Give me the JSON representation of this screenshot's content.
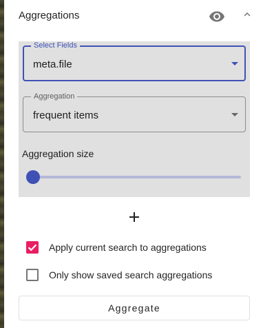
{
  "panel": {
    "title": "Aggregations"
  },
  "icons": {
    "visibility": "eye-icon",
    "collapse": "chevron-up-icon",
    "add": "plus-icon",
    "checked": "check-icon"
  },
  "select_fields": {
    "label": "Select Fields",
    "value": "meta.file"
  },
  "aggregation": {
    "label": "Aggregation",
    "value": "frequent items"
  },
  "aggregation_size": {
    "label": "Aggregation size",
    "level": 0
  },
  "options": {
    "apply_current_search": {
      "label": "Apply current search to aggregations",
      "checked": true
    },
    "only_saved_search": {
      "label": "Only show saved search aggregations",
      "checked": false
    }
  },
  "actions": {
    "aggregate_label": "Aggregate"
  },
  "colors": {
    "primary": "#3f51b5",
    "checkbox_accent": "#e91e63",
    "panel_background": "#e0e0e0"
  }
}
